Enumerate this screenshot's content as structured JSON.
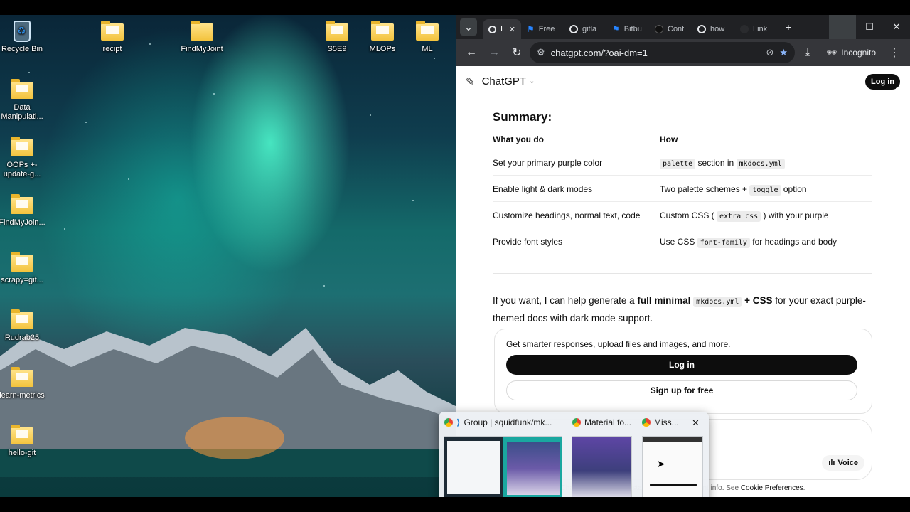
{
  "desktop": {
    "icons": [
      {
        "label": "Recycle Bin"
      },
      {
        "label": "recipt"
      },
      {
        "label": "FindMyJoint"
      },
      {
        "label": "S5E9"
      },
      {
        "label": "MLOPs"
      },
      {
        "label": "ML"
      },
      {
        "label": "Data Manipulati..."
      },
      {
        "label": "OOPs +-update-g..."
      },
      {
        "label": "FindMyJoin..."
      },
      {
        "label": "scrapy=git..."
      },
      {
        "label": "Rudrab25"
      },
      {
        "label": "learn-metrics"
      },
      {
        "label": "hello-git"
      }
    ]
  },
  "browser": {
    "tabs": [
      {
        "label": "I",
        "favicon": "chatgpt-icon",
        "color": "#e8eaed"
      },
      {
        "label": "Free",
        "favicon": "bookmark-icon",
        "color": "#2684ff"
      },
      {
        "label": "gitla",
        "favicon": "google-icon",
        "color": "#e8eaed"
      },
      {
        "label": "Bitbu",
        "favicon": "bookmark-icon",
        "color": "#2684ff"
      },
      {
        "label": "Cont",
        "favicon": "github-icon",
        "color": "#111"
      },
      {
        "label": "how",
        "favicon": "google-icon",
        "color": "#e8eaed"
      },
      {
        "label": "Link",
        "favicon": "blank-icon",
        "color": "#202124"
      }
    ],
    "new_tab": "+",
    "url": "chatgpt.com/?oai-dm=1",
    "incognito_label": "Incognito"
  },
  "chatgpt": {
    "brand": "ChatGPT",
    "login_top": "Log in",
    "summary_title": "Summary:",
    "table": {
      "headers": [
        "What you do",
        "How"
      ],
      "rows": [
        {
          "what": "Set your primary purple color",
          "how_parts": [
            {
              "code": "palette"
            },
            {
              "text": " section in "
            },
            {
              "code": "mkdocs.yml"
            }
          ]
        },
        {
          "what": "Enable light & dark modes",
          "how_parts": [
            {
              "text": "Two palette schemes + "
            },
            {
              "code": "toggle"
            },
            {
              "text": " option"
            }
          ]
        },
        {
          "what": "Customize headings, normal text, code",
          "how_parts": [
            {
              "text": "Custom CSS ( "
            },
            {
              "code": "extra_css"
            },
            {
              "text": " ) with your purple"
            }
          ]
        },
        {
          "what": "Provide font styles",
          "how_parts": [
            {
              "text": "Use CSS "
            },
            {
              "code": "font-family"
            },
            {
              "text": " for headings and body"
            }
          ]
        }
      ]
    },
    "closing": {
      "prefix": "If you want, I can help generate a ",
      "bold1": "full minimal",
      "code": "mkdocs.yml",
      "plus": " + ",
      "bold2": "CSS",
      "suffix": " for your exact purple-themed docs with dark mode support."
    },
    "card": {
      "text": "Get smarter responses, upload files and images, and more.",
      "login": "Log in",
      "signup": "Sign up for free"
    },
    "voice": "Voice",
    "footer_text": "ChatGPT can make mistakes. Check important info. See ",
    "footer_link": "Cookie Preferences",
    "footer_end": "."
  },
  "taskbar_preview": {
    "items": [
      {
        "label": "Group | squidfunk/mk...",
        "icon": "chrome-icon"
      },
      {
        "label": "Material fo...",
        "icon": "chrome-icon"
      },
      {
        "label": "Miss...",
        "icon": "chrome-icon"
      }
    ],
    "close": "✕"
  }
}
